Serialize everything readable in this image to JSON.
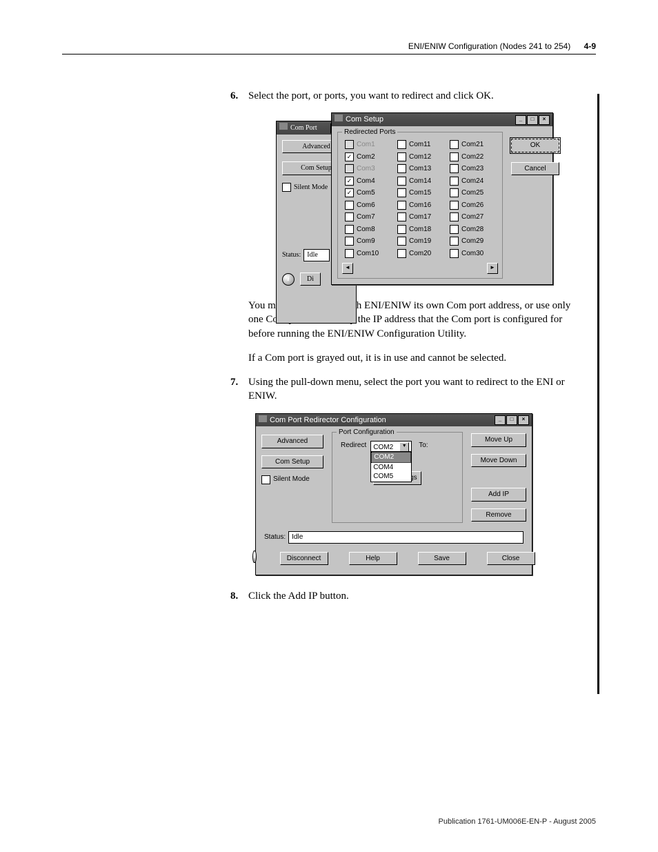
{
  "header": {
    "section": "ENI/ENIW Configuration (Nodes 241 to 254)",
    "page": "4-9"
  },
  "steps": {
    "s6num": "6.",
    "s6text": "Select the port, or ports, you want to redirect and click OK.",
    "s6para1": "You may either assign each ENI/ENIW its own Com port address, or use only one Com port and modify the IP address that the Com port is configured for before running the ENI/ENIW Configuration Utility.",
    "s6para2": "If a Com port is grayed out, it is in use and cannot be selected.",
    "s7num": "7.",
    "s7text": "Using the pull-down menu, select the port you want to redirect to the ENI or ENIW.",
    "s8num": "8.",
    "s8text": "Click the Add IP button."
  },
  "fig1": {
    "behindTitle": "Com Port",
    "frontTitle": "Com Setup",
    "groupLabel": "Redirected Ports",
    "advanced": "Advanced",
    "comsetup": "Com Setup",
    "silent": "Silent Mode",
    "statusLabel": "Status:",
    "statusValue": "Idle",
    "di": "Di",
    "ok": "OK",
    "cancel": "Cancel",
    "ports": {
      "col1": [
        "Com1",
        "Com2",
        "Com3",
        "Com4",
        "Com5",
        "Com6",
        "Com7",
        "Com8",
        "Com9",
        "Com10"
      ],
      "col2": [
        "Com11",
        "Com12",
        "Com13",
        "Com14",
        "Com15",
        "Com16",
        "Com17",
        "Com18",
        "Com19",
        "Com20"
      ],
      "col3": [
        "Com21",
        "Com22",
        "Com23",
        "Com24",
        "Com25",
        "Com26",
        "Com27",
        "Com28",
        "Com29",
        "Com30"
      ]
    },
    "checked": [
      "Com2",
      "Com4",
      "Com5"
    ],
    "disabled": [
      "Com1",
      "Com3"
    ]
  },
  "fig2": {
    "title": "Com Port Redirector Configuration",
    "group": "Port Configuration",
    "advanced": "Advanced",
    "comsetup": "Com Setup",
    "silent": "Silent Mode",
    "redirectLabel": "Redirect",
    "toLabel": "To:",
    "selected": "COM2",
    "options": [
      "COM2",
      "COM4",
      "COM5"
    ],
    "moveup": "Move Up",
    "movedown": "Move Down",
    "addip": "Add IP",
    "remove": "Remove",
    "portsettings": "Port Settings",
    "statusLabel": "Status:",
    "statusValue": "Idle",
    "disconnect": "Disconnect",
    "help": "Help",
    "save": "Save",
    "close": "Close"
  },
  "footer": "Publication 1761-UM006E-EN-P - August 2005"
}
